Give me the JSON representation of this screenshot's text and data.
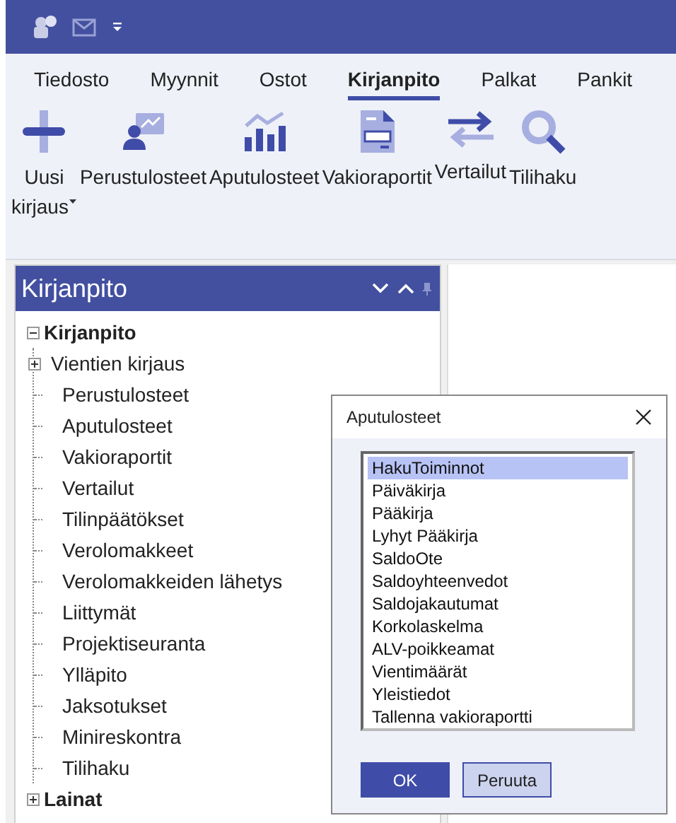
{
  "ribbon": {
    "tabs": [
      {
        "label": "Tiedosto",
        "selected": false
      },
      {
        "label": "Myynnit",
        "selected": false
      },
      {
        "label": "Ostot",
        "selected": false
      },
      {
        "label": "Kirjanpito",
        "selected": true
      },
      {
        "label": "Palkat",
        "selected": false
      },
      {
        "label": "Pankit",
        "selected": false
      }
    ],
    "buttons": [
      {
        "kind": "plus",
        "lines": [
          "Uusi",
          "kirjaus"
        ],
        "dropdown": true
      },
      {
        "kind": "person-chart",
        "lines": [
          "Perustulosteet"
        ],
        "dropdown": false
      },
      {
        "kind": "bar-chart",
        "lines": [
          "Aputulosteet"
        ],
        "dropdown": false
      },
      {
        "kind": "document",
        "lines": [
          "Vakioraportit"
        ],
        "dropdown": false
      },
      {
        "kind": "arrows",
        "lines": [
          "Vertailut"
        ],
        "dropdown": false
      },
      {
        "kind": "search",
        "lines": [
          "Tilihaku"
        ],
        "dropdown": false
      }
    ]
  },
  "panel": {
    "title": "Kirjanpito",
    "tree": [
      {
        "label": "Kirjanpito",
        "expanded": true,
        "children": [
          {
            "label": "Vientien kirjaus",
            "expanded": false
          },
          {
            "label": "Perustulosteet"
          },
          {
            "label": "Aputulosteet"
          },
          {
            "label": "Vakioraportit"
          },
          {
            "label": "Vertailut"
          },
          {
            "label": "Tilinpäätökset"
          },
          {
            "label": "Verolomakkeet"
          },
          {
            "label": "Verolomakkeiden lähetys"
          },
          {
            "label": "Liittymät"
          },
          {
            "label": "Projektiseuranta"
          },
          {
            "label": "Ylläpito"
          },
          {
            "label": "Jaksotukset"
          },
          {
            "label": "Minireskontra"
          },
          {
            "label": "Tilihaku"
          }
        ]
      },
      {
        "label": "Lainat",
        "expanded": false
      }
    ]
  },
  "dialog": {
    "title": "Aputulosteet",
    "items": [
      {
        "label": "HakuToiminnot",
        "selected": true
      },
      {
        "label": "Päiväkirja",
        "selected": false
      },
      {
        "label": "Pääkirja",
        "selected": false
      },
      {
        "label": "Lyhyt Pääkirja",
        "selected": false
      },
      {
        "label": "SaldoOte",
        "selected": false
      },
      {
        "label": "Saldoyhteenvedot",
        "selected": false
      },
      {
        "label": "Saldojakautumat",
        "selected": false
      },
      {
        "label": "Korkolaskelma",
        "selected": false
      },
      {
        "label": "ALV-poikkeamat",
        "selected": false
      },
      {
        "label": "Vientimäärät",
        "selected": false
      },
      {
        "label": "Yleistiedot",
        "selected": false
      },
      {
        "label": "Tallenna vakioraportti",
        "selected": false
      }
    ],
    "buttons": [
      {
        "label": "OK",
        "kind": "primary"
      },
      {
        "label": "Peruuta",
        "kind": "secondary"
      }
    ]
  }
}
